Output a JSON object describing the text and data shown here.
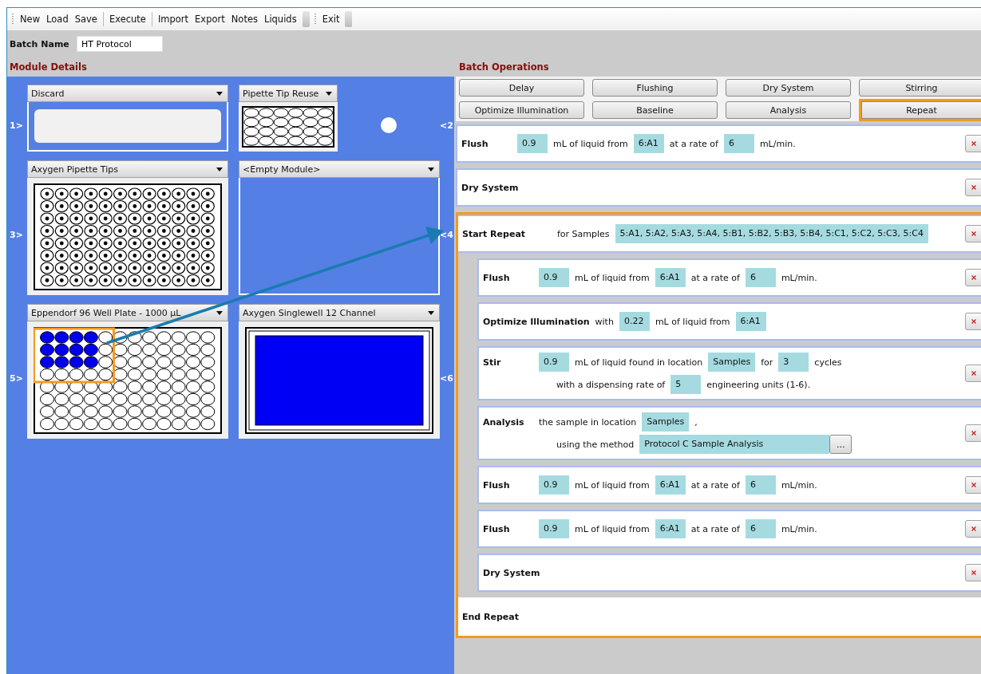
{
  "toolbars": [
    {
      "groups": [
        [
          "New",
          "Load",
          "Save"
        ],
        [
          "Execute"
        ],
        [
          "Import",
          "Export",
          "Notes",
          "Liquids"
        ]
      ]
    },
    {
      "groups": [
        [
          "Exit"
        ]
      ]
    }
  ],
  "batch_name": {
    "label": "Batch Name",
    "value": "HT Protocol"
  },
  "module_details": {
    "title": "Module Details",
    "rows": [
      {
        "left_label": "1>",
        "right_label": "<2",
        "dot": true,
        "slots": [
          {
            "kind": "discard",
            "name": "Discard"
          },
          {
            "kind": "tip_reuse",
            "name": "Pipette Tip Reuse"
          }
        ]
      },
      {
        "left_label": "3>",
        "right_label": "<4",
        "dot": false,
        "slots": [
          {
            "kind": "tip_rack",
            "name": "Axygen Pipette Tips"
          },
          {
            "kind": "empty",
            "name": "<Empty Module>"
          }
        ]
      },
      {
        "left_label": "5>",
        "right_label": "<6",
        "dot": false,
        "slots": [
          {
            "kind": "well_plate",
            "name": "Eppendorf 96 Well Plate - 1000 µL",
            "filled": [
              [
                true,
                true,
                true,
                true,
                false,
                false,
                false,
                false,
                false,
                false,
                false,
                false
              ],
              [
                true,
                true,
                true,
                true,
                false,
                false,
                false,
                false,
                false,
                false,
                false,
                false
              ],
              [
                true,
                true,
                true,
                true,
                false,
                false,
                false,
                false,
                false,
                false,
                false,
                false
              ],
              [
                false,
                false,
                false,
                false,
                false,
                false,
                false,
                false,
                false,
                false,
                false,
                false
              ],
              [
                false,
                false,
                false,
                false,
                false,
                false,
                false,
                false,
                false,
                false,
                false,
                false
              ],
              [
                false,
                false,
                false,
                false,
                false,
                false,
                false,
                false,
                false,
                false,
                false,
                false
              ],
              [
                false,
                false,
                false,
                false,
                false,
                false,
                false,
                false,
                false,
                false,
                false,
                false
              ],
              [
                false,
                false,
                false,
                false,
                false,
                false,
                false,
                false,
                false,
                false,
                false,
                false
              ]
            ]
          },
          {
            "kind": "reservoir",
            "name": "Axygen Singlewell 12 Channel"
          }
        ]
      }
    ]
  },
  "batch_operations": {
    "title": "Batch Operations",
    "buttons": [
      {
        "label": "Delay",
        "highlighted": false
      },
      {
        "label": "Flushing",
        "highlighted": false
      },
      {
        "label": "Dry System",
        "highlighted": false
      },
      {
        "label": "Stirring",
        "highlighted": false
      },
      {
        "label": "Optimize Illumination",
        "highlighted": false
      },
      {
        "label": "Baseline",
        "highlighted": false
      },
      {
        "label": "Analysis",
        "highlighted": false
      },
      {
        "label": "Repeat",
        "highlighted": true
      }
    ],
    "steps": [
      {
        "kind": "step",
        "title": "Flush",
        "lines": [
          [
            {
              "kind": "field",
              "text": "0.9"
            },
            {
              "kind": "text",
              "text": "mL of liquid from"
            },
            {
              "kind": "field",
              "text": "6:A1"
            },
            {
              "kind": "text",
              "text": "at a rate of"
            },
            {
              "kind": "field",
              "text": "6"
            },
            {
              "kind": "text",
              "text": "mL/min."
            }
          ]
        ]
      },
      {
        "kind": "step",
        "title": "Dry System"
      },
      {
        "kind": "repeat",
        "title": "Start Repeat",
        "highlighted": true,
        "end_title": "End Repeat",
        "lines": [
          [
            {
              "kind": "text",
              "text": "for Samples"
            },
            {
              "kind": "field",
              "text": "5:A1, 5:A2, 5:A3, 5:A4, 5:B1, 5:B2, 5:B3, 5:B4, 5:C1, 5:C2, 5:C3, 5:C4"
            }
          ]
        ],
        "children": [
          {
            "kind": "step",
            "title": "Flush",
            "lines": [
              [
                {
                  "kind": "field",
                  "text": "0.9"
                },
                {
                  "kind": "text",
                  "text": "mL of liquid from"
                },
                {
                  "kind": "field",
                  "text": "6:A1"
                },
                {
                  "kind": "text",
                  "text": "at a rate of"
                },
                {
                  "kind": "field",
                  "text": "6"
                },
                {
                  "kind": "text",
                  "text": "mL/min."
                }
              ]
            ]
          },
          {
            "kind": "step",
            "title": "Optimize Illumination",
            "lines": [
              [
                {
                  "kind": "text",
                  "text": "with"
                },
                {
                  "kind": "field",
                  "text": "0.22"
                },
                {
                  "kind": "text",
                  "text": "mL of liquid from"
                },
                {
                  "kind": "field",
                  "text": "6:A1"
                }
              ]
            ]
          },
          {
            "kind": "step",
            "title": "Stir",
            "lines": [
              [
                {
                  "kind": "field",
                  "text": "0.9"
                },
                {
                  "kind": "text",
                  "text": "mL of liquid found in location"
                },
                {
                  "kind": "field",
                  "text": "Samples"
                },
                {
                  "kind": "text",
                  "text": "for"
                },
                {
                  "kind": "field",
                  "text": "3"
                },
                {
                  "kind": "text",
                  "text": "cycles"
                }
              ],
              [
                {
                  "kind": "text",
                  "text": "with a dispensing rate of"
                },
                {
                  "kind": "field",
                  "text": "5"
                },
                {
                  "kind": "text",
                  "text": "engineering units (1-6)."
                }
              ]
            ]
          },
          {
            "kind": "step",
            "title": "Analysis",
            "lines": [
              [
                {
                  "kind": "text",
                  "text": "the sample in location"
                },
                {
                  "kind": "field",
                  "text": "Samples"
                },
                {
                  "kind": "text",
                  "text": ","
                }
              ],
              [
                {
                  "kind": "text",
                  "text": "using the method"
                },
                {
                  "kind": "method",
                  "text": "Protocol C Sample Analysis"
                },
                {
                  "kind": "browse",
                  "text": "..."
                }
              ]
            ]
          },
          {
            "kind": "step",
            "title": "Flush",
            "lines": [
              [
                {
                  "kind": "field",
                  "text": "0.9"
                },
                {
                  "kind": "text",
                  "text": "mL of liquid from"
                },
                {
                  "kind": "field",
                  "text": "6:A1"
                },
                {
                  "kind": "text",
                  "text": "at a rate of"
                },
                {
                  "kind": "field",
                  "text": "6"
                },
                {
                  "kind": "text",
                  "text": "mL/min."
                }
              ]
            ]
          },
          {
            "kind": "step",
            "title": "Flush",
            "lines": [
              [
                {
                  "kind": "field",
                  "text": "0.9"
                },
                {
                  "kind": "text",
                  "text": "mL of liquid from"
                },
                {
                  "kind": "field",
                  "text": "6:A1"
                },
                {
                  "kind": "text",
                  "text": "at a rate of"
                },
                {
                  "kind": "field",
                  "text": "6"
                },
                {
                  "kind": "text",
                  "text": "mL/min."
                }
              ]
            ]
          },
          {
            "kind": "step",
            "title": "Dry System"
          }
        ]
      }
    ]
  }
}
